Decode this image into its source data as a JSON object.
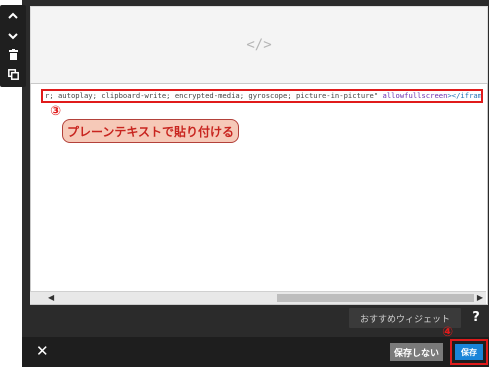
{
  "toolbar": {
    "up_icon": "chevron-up-icon",
    "down_icon": "chevron-down-icon",
    "delete_icon": "trash-icon",
    "copy_icon": "copy-icon"
  },
  "preview": {
    "placeholder_symbol": "</>"
  },
  "editor": {
    "code_plain": "r; autoplay; clipboard-write; encrypted-media; gyroscope; picture-in-picture\" ",
    "code_attr": "allowfullscreen",
    "code_tag": "></iframe>"
  },
  "annotations": {
    "step3": "③",
    "step3_callout": "プレーンテキストで貼り付ける",
    "step4": "④"
  },
  "widget_bar": {
    "recommended_widget": "おすすめウィジェット",
    "help": "?"
  },
  "bottom_bar": {
    "close": "✕",
    "dont_save": "保存しない",
    "save": "保存"
  },
  "colors": {
    "accent_blue": "#1a84d8",
    "annotation_red": "#e01b1b",
    "dark_frame": "#2b2b2b"
  }
}
